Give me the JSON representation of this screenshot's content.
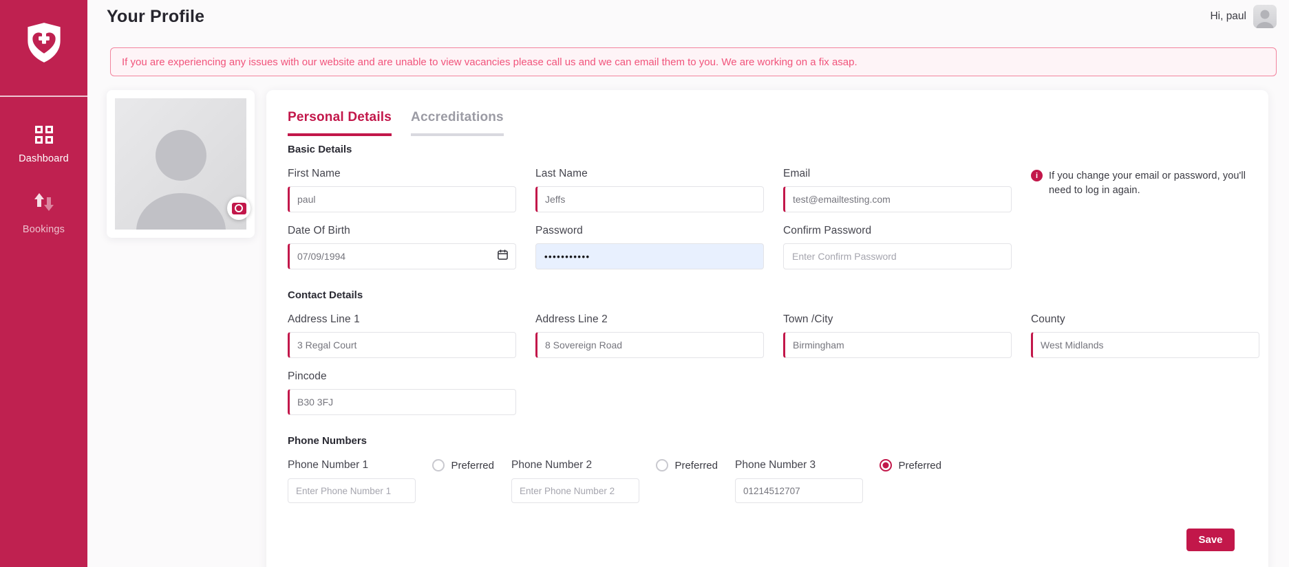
{
  "colors": {
    "sidebar": "#bf2150",
    "accent": "#c2174a",
    "alert_text": "#f1537b",
    "alert_border": "#f2839d",
    "alert_bg": "#fef4f7",
    "password_autofill_bg": "#e8f0fe"
  },
  "sidebar": {
    "logo_icon": "shield-heart-cross-icon",
    "items": [
      {
        "label": "Dashboard",
        "icon": "grid-icon",
        "active": true
      },
      {
        "label": "Bookings",
        "icon": "arrows-up-down-icon",
        "active": false
      }
    ]
  },
  "header": {
    "title": "Your Profile",
    "greeting": "Hi, paul",
    "avatar_icon": "person-icon"
  },
  "alert": {
    "text": "If you are experiencing any issues with our website and are unable to view vacancies please call us and we can email them to you. We are working on a fix asap."
  },
  "profile_photo": {
    "placeholder_icon": "person-icon",
    "camera_icon": "camera-icon"
  },
  "tabs": [
    {
      "label": "Personal Details",
      "active": true
    },
    {
      "label": "Accreditations",
      "active": false
    }
  ],
  "basic_details": {
    "section_title": "Basic Details",
    "first_name": {
      "label": "First Name",
      "value": "paul"
    },
    "last_name": {
      "label": "Last Name",
      "value": "Jeffs"
    },
    "email": {
      "label": "Email",
      "value": "test@emailtesting.com"
    },
    "dob": {
      "label": "Date Of Birth",
      "value": "07/09/1994",
      "icon": "calendar-icon"
    },
    "password": {
      "label": "Password",
      "value": "•••••••••••"
    },
    "confirm_password": {
      "label": "Confirm Password",
      "placeholder": "Enter Confirm Password"
    },
    "note": {
      "icon": "info-icon",
      "text": "If you change your email or password, you'll need to log in again."
    }
  },
  "contact_details": {
    "section_title": "Contact Details",
    "address1": {
      "label": "Address Line 1",
      "value": "3 Regal Court"
    },
    "address2": {
      "label": "Address Line 2",
      "value": "8 Sovereign Road"
    },
    "town": {
      "label": "Town /City",
      "value": "Birmingham"
    },
    "county": {
      "label": "County",
      "value": "West Midlands"
    },
    "pincode": {
      "label": "Pincode",
      "value": "B30 3FJ"
    }
  },
  "phone_numbers": {
    "section_title": "Phone Numbers",
    "preferred_label": "Preferred",
    "items": [
      {
        "label": "Phone Number 1",
        "placeholder": "Enter Phone Number 1",
        "value": "",
        "preferred": false
      },
      {
        "label": "Phone Number 2",
        "placeholder": "Enter Phone Number 2",
        "value": "",
        "preferred": false
      },
      {
        "label": "Phone Number 3",
        "placeholder": "",
        "value": "01214512707",
        "preferred": true
      }
    ]
  },
  "actions": {
    "save_label": "Save"
  }
}
